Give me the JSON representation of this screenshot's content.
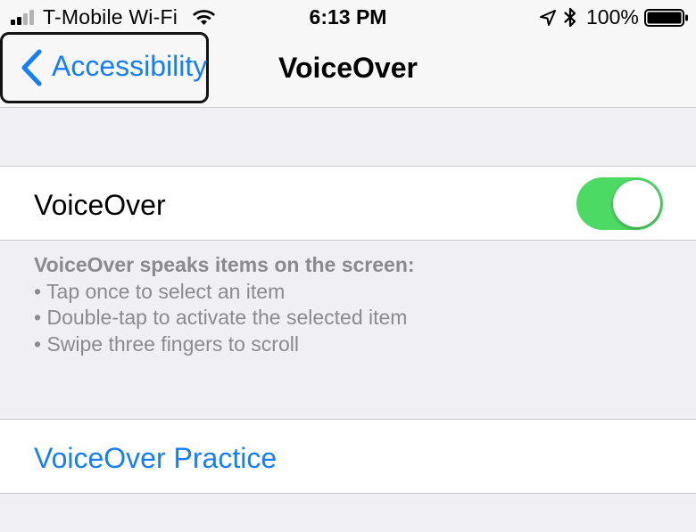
{
  "status_bar": {
    "carrier": "T-Mobile Wi-Fi",
    "time": "6:13 PM",
    "battery_percent": "100%",
    "signal_strength_bars": 2,
    "signal_total_bars": 4,
    "battery_level": 1.0,
    "icons": [
      "signal-icon",
      "wifi-icon",
      "location-icon",
      "bluetooth-icon",
      "battery-icon"
    ]
  },
  "nav": {
    "back_label": "Accessibility",
    "title": "VoiceOver"
  },
  "voiceover_row": {
    "label": "VoiceOver",
    "toggle_on": true
  },
  "footer": {
    "heading": "VoiceOver speaks items on the screen:",
    "bullets": [
      "Tap once to select an item",
      "Double-tap to activate the selected item",
      "Swipe three fingers to scroll"
    ]
  },
  "practice_row": {
    "label": "VoiceOver Practice"
  },
  "colors": {
    "accent": "#147efb",
    "toggle_on": "#4cd964",
    "background": "#efeff4",
    "footer_text": "#8a8a8f",
    "separator": "#c8c7cc"
  }
}
